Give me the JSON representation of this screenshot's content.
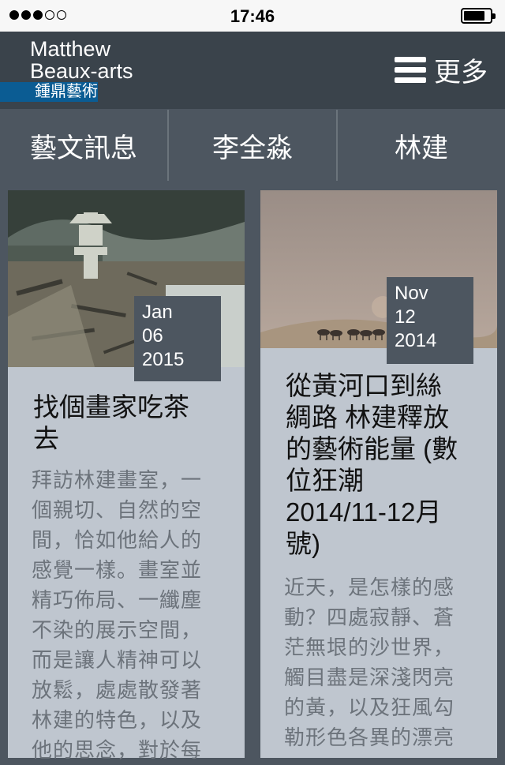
{
  "status_bar": {
    "time": "17:46"
  },
  "header": {
    "logo_line1": "Matthew",
    "logo_line2": "Beaux-arts",
    "logo_chinese": "鍾鼎藝術",
    "menu_label": "更多"
  },
  "nav": {
    "tabs": [
      "藝文訊息",
      "李全淼",
      "林建"
    ]
  },
  "cards": [
    {
      "date_month": "Jan",
      "date_day": "06",
      "date_year": "2015",
      "title_lines": [
        "找個畫家吃茶",
        "去"
      ],
      "excerpt_lines": [
        "拜訪林建畫室，一",
        "個親切、自然的空",
        "間，恰如他給人的",
        "感覺一樣。畫室並",
        "精巧佈局、一纖塵",
        "不染的展示空間，",
        "而是讓人精神可以",
        "放鬆，處處散發著",
        "林建的特色，以及",
        "他的思念，對於每"
      ]
    },
    {
      "date_month": "Nov",
      "date_day": "12",
      "date_year": "2014",
      "title_lines": [
        "從黃河口到絲",
        "綢路 林建釋放",
        "的藝術能量 (數",
        "位狂潮",
        "2014/11-12月",
        "號)"
      ],
      "excerpt_lines": [
        "近天，是怎樣的感",
        "動？四處寂靜、蒼",
        "茫無垠的沙世界，",
        "觸目盡是深淺閃亮",
        "的黃，以及狂風勾",
        "勒形色各異的漂亮"
      ]
    }
  ]
}
